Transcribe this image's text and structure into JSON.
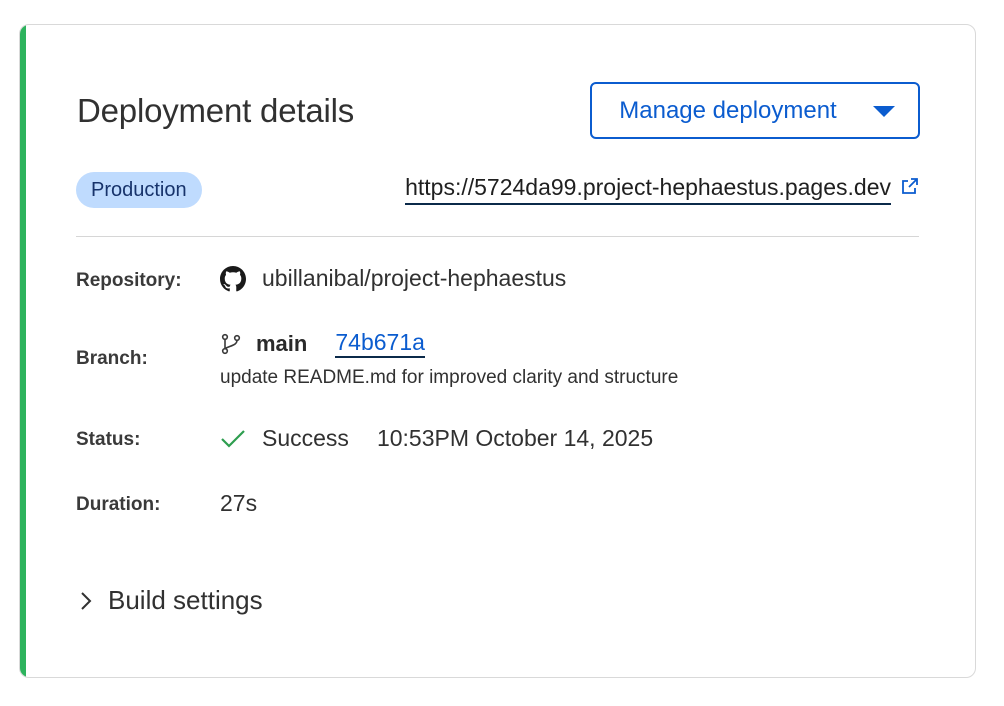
{
  "card": {
    "title": "Deployment details",
    "manage_button_label": "Manage deployment",
    "environment_badge": "Production",
    "deployment_url": "https://5724da99.project-hephaestus.pages.dev",
    "accent_color": "#2db35d"
  },
  "details": {
    "repository": {
      "label": "Repository:",
      "value": "ubillanibal/project-hephaestus",
      "icon": "github-icon"
    },
    "branch": {
      "label": "Branch:",
      "name": "main",
      "commit": "74b671a",
      "commit_message": "update README.md for improved clarity and structure",
      "icon": "git-branch-icon"
    },
    "status": {
      "label": "Status:",
      "value": "Success",
      "timestamp": "10:53PM October 14, 2025",
      "icon": "check-icon",
      "color": "#2e9e4f"
    },
    "duration": {
      "label": "Duration:",
      "value": "27s"
    }
  },
  "build_settings": {
    "label": "Build settings",
    "icon": "chevron-right-icon"
  }
}
